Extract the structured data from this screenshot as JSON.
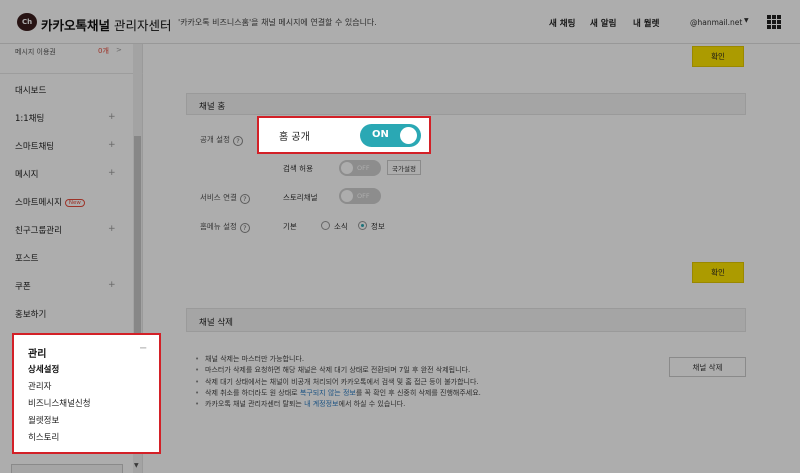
{
  "header": {
    "logo_text": "Ch",
    "app_title_bold": "카카오톡채널",
    "app_title_rest": " 관리자센터",
    "notice": "'카카오톡 비즈니스홈'을 채널 메시지에 연결할 수 있습니다.",
    "nav": [
      "새 채팅",
      "새 알림",
      "내 월렛"
    ],
    "email": "@hanmail.net",
    "caret": "▼"
  },
  "sidebar": {
    "msg_label": "메시지 이용권",
    "msg_count": "0개",
    "msg_arrow": ">",
    "items": [
      {
        "label": "대시보드",
        "plus": ""
      },
      {
        "label": "1:1채팅",
        "plus": "+"
      },
      {
        "label": "스마트채팅",
        "plus": "+"
      },
      {
        "label": "메시지",
        "plus": "+"
      },
      {
        "label": "스마트메시지",
        "plus": "",
        "badge": "New"
      },
      {
        "label": "친구그룹관리",
        "plus": "+"
      },
      {
        "label": "포스트",
        "plus": ""
      },
      {
        "label": "쿠폰",
        "plus": "+"
      },
      {
        "label": "홍보하기",
        "plus": ""
      }
    ],
    "scroll_down": "▼"
  },
  "management": {
    "title": "관리",
    "collapse": "−",
    "items": [
      "상세설정",
      "관리자",
      "비즈니스채널신청",
      "월렛정보",
      "히스토리"
    ]
  },
  "main": {
    "confirm_top": "확인",
    "home_section": "채널 홈",
    "public_setting_label": "공개 설정",
    "help_glyph": "?",
    "home_public_label": "홈 공개",
    "home_public_state": "ON",
    "search_allow_label": "검색 허용",
    "off_label": "OFF",
    "country_button": "국가설정",
    "service_link_label": "서비스 연결",
    "story_channel_label": "스토리채널",
    "home_menu_label": "홈메뉴 설정",
    "home_menu_default": "기본",
    "radio_news": "소식",
    "radio_info": "정보",
    "confirm_mid": "확인",
    "delete_section": "채널 삭제",
    "delete_button": "채널 삭제",
    "bullets": [
      {
        "text": "채널 삭제는 마스터만 가능합니다."
      },
      {
        "text": "마스터가 삭제를 요청하면 해당 채널은 삭제 대기 상태로 전환되며 7일 후 완전 삭제됩니다."
      },
      {
        "text": "삭제 대기 상태에서는 채널이 비공개 처리되어 카카오톡에서 검색 및 홈 접근 등이 불가합니다."
      },
      {
        "pre": "삭제 취소를 하더라도 원 상태로 ",
        "link": "복구되지 않는 정보",
        "post": "를 꼭 확인 후 신중히 삭제를 진행해주세요."
      },
      {
        "pre": "카카오톡 채널 관리자센터 탈퇴는 ",
        "link": "내 계정정보",
        "post": "에서 하실 수 있습니다."
      }
    ]
  },
  "colors": {
    "accent_teal": "#2aa8b4",
    "confirm_yellow": "#fee500",
    "callout_red": "#d32027"
  }
}
